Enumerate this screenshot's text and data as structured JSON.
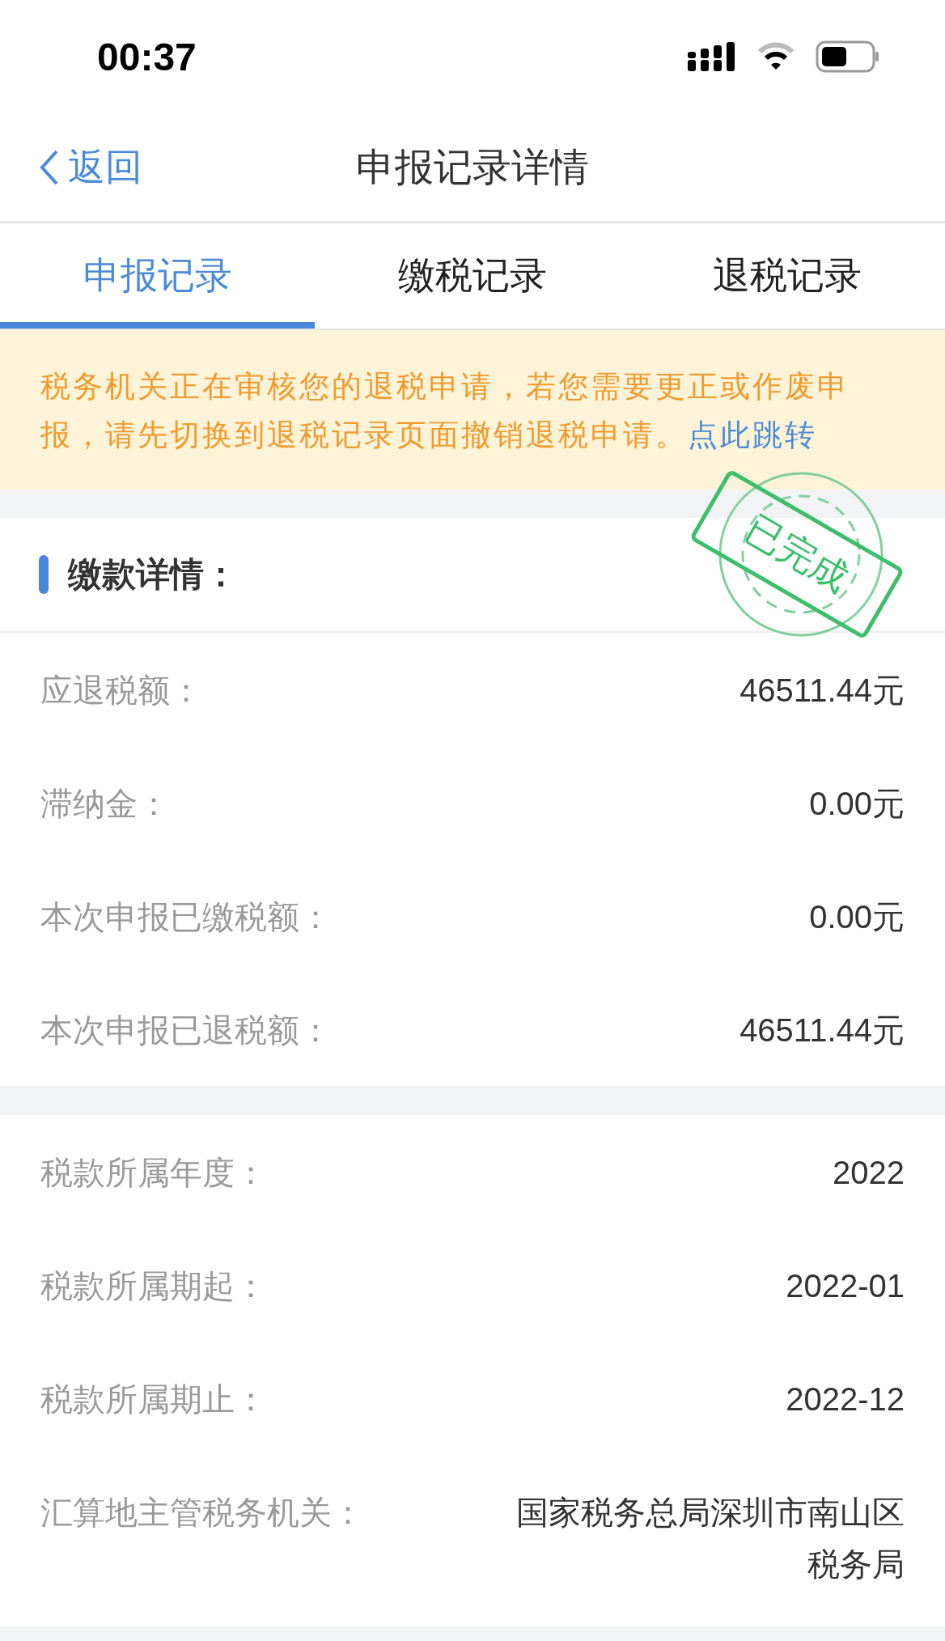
{
  "status_bar": {
    "time": "00:37"
  },
  "nav": {
    "back": "返回",
    "title": "申报记录详情"
  },
  "tabs": [
    {
      "label": "申报记录",
      "selected": true
    },
    {
      "label": "缴税记录",
      "selected": false
    },
    {
      "label": "退税记录",
      "selected": false
    }
  ],
  "notice": {
    "text": "税务机关正在审核您的退税申请，若您需要更正或作废申报，请先切换到退税记录页面撤销退税申请。",
    "link": "点此跳转"
  },
  "stamp": {
    "text": "已完成"
  },
  "section": {
    "title": "缴款详情："
  },
  "groups": [
    {
      "rows": [
        {
          "label": "应退税额：",
          "value": "46511.44元"
        },
        {
          "label": "滞纳金：",
          "value": "0.00元"
        },
        {
          "label": "本次申报已缴税额：",
          "value": "0.00元"
        },
        {
          "label": "本次申报已退税额：",
          "value": "46511.44元"
        }
      ]
    },
    {
      "rows": [
        {
          "label": "税款所属年度：",
          "value": "2022"
        },
        {
          "label": "税款所属期起：",
          "value": "2022-01"
        },
        {
          "label": "税款所属期止：",
          "value": "2022-12"
        },
        {
          "label": "汇算地主管税务机关：",
          "value": "国家税务总局深圳市南山区税务局"
        }
      ]
    }
  ]
}
